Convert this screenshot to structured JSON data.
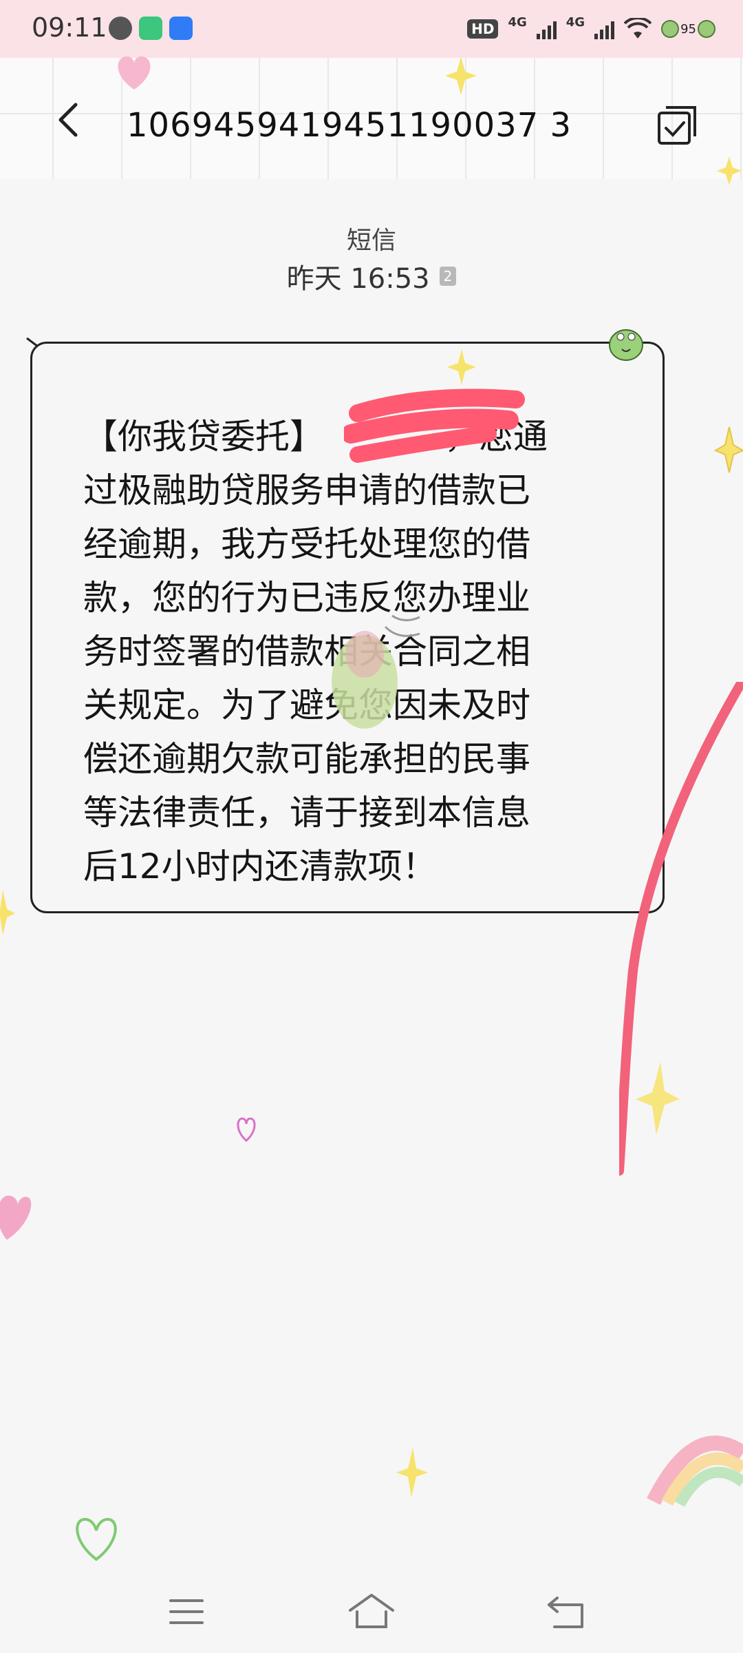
{
  "status_bar": {
    "time": "09:11",
    "hd_label": "HD",
    "net1": "4G",
    "net2": "4G",
    "battery_level": "95"
  },
  "header": {
    "title": "1069459419451190037 3"
  },
  "conversation": {
    "message_type": "短信",
    "timestamp": "昨天 16:53",
    "sim_slot": "2"
  },
  "message": {
    "lines": [
      "【你我贷委托】　　　　，您通",
      "过极融助贷服务申请的借款已",
      "经逾期，我方受托处理您的借",
      "款，您的行为已违反您办理业",
      "务时签署的借款相关合同之相",
      "关规定。为了避免您因未及时",
      "偿还逾期欠款可能承担的民事",
      "等法律责任，请于接到本信息",
      "后12小时内还清款项！"
    ]
  },
  "colors": {
    "status_bar_bg": "#fbe2e7",
    "background": "#f6f6f7",
    "redaction": "#ff5a72",
    "star": "#f7e36b",
    "heart_pink": "#f2a7c6"
  },
  "icons": {
    "back": "back-arrow-icon",
    "multi_select": "multi-select-icon",
    "menu": "menu-icon",
    "home": "home-icon",
    "return": "return-icon"
  }
}
